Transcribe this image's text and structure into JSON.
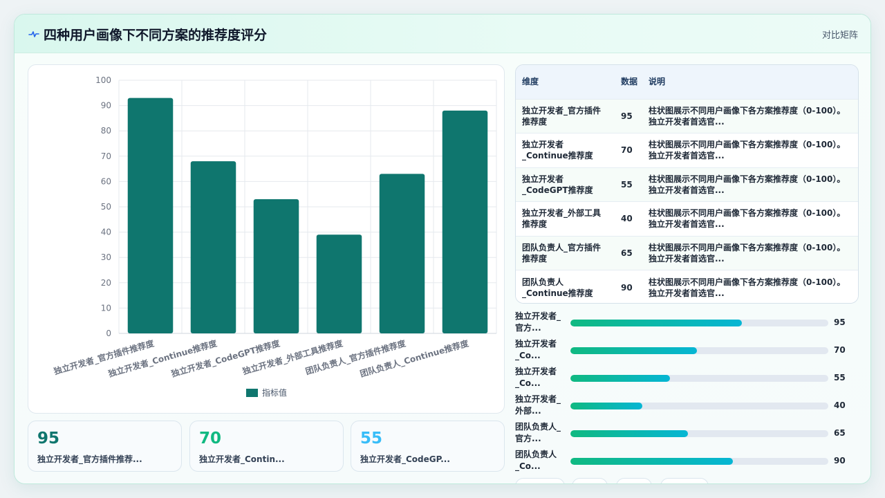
{
  "header": {
    "title": "四种用户画像下不同方案的推荐度评分",
    "right_label": "对比矩阵",
    "logo_icon": "pulse-icon"
  },
  "chart_data": {
    "type": "bar",
    "categories": [
      "独立开发者_官方插件推荐度",
      "独立开发者_Continue推荐度",
      "独立开发者_CodeGPT推荐度",
      "独立开发者_外部工具推荐度",
      "团队负责人_官方插件推荐度",
      "团队负责人_Continue推荐度"
    ],
    "series": [
      {
        "name": "指标值",
        "values": [
          93,
          68,
          53,
          39,
          63,
          88
        ]
      }
    ],
    "ylim": [
      0,
      100
    ],
    "yticks": [
      0,
      10,
      20,
      30,
      40,
      50,
      60,
      70,
      80,
      90,
      100
    ],
    "grid": true,
    "legend": "bottom",
    "bar_color": "#0f766e"
  },
  "stats": [
    {
      "value": "95",
      "label": "独立开发者_官方插件推荐...",
      "color": "#0f766e"
    },
    {
      "value": "70",
      "label": "独立开发者_Contin...",
      "color": "#10b981"
    },
    {
      "value": "55",
      "label": "独立开发者_CodeGP...",
      "color": "#38bdf8"
    }
  ],
  "table": {
    "headers": [
      "维度",
      "数据",
      "说明"
    ],
    "rows": [
      {
        "dim": "独立开发者_官方插件推荐度",
        "value": "95",
        "desc": "柱状图展示不同用户画像下各方案推荐度（0-100）。独立开发者首选官..."
      },
      {
        "dim": "独立开发者_Continue推荐度",
        "value": "70",
        "desc": "柱状图展示不同用户画像下各方案推荐度（0-100）。独立开发者首选官..."
      },
      {
        "dim": "独立开发者_CodeGPT推荐度",
        "value": "55",
        "desc": "柱状图展示不同用户画像下各方案推荐度（0-100）。独立开发者首选官..."
      },
      {
        "dim": "独立开发者_外部工具推荐度",
        "value": "40",
        "desc": "柱状图展示不同用户画像下各方案推荐度（0-100）。独立开发者首选官..."
      },
      {
        "dim": "团队负责人_官方插件推荐度",
        "value": "65",
        "desc": "柱状图展示不同用户画像下各方案推荐度（0-100）。独立开发者首选官..."
      },
      {
        "dim": "团队负责人_Continue推荐度",
        "value": "90",
        "desc": "柱状图展示不同用户画像下各方案推荐度（0-100）。独立开发者首选官..."
      }
    ]
  },
  "progress": [
    {
      "label": "独立开发者_官方...",
      "value": "95",
      "fraction": 0.665
    },
    {
      "label": "独立开发者_Co...",
      "value": "70",
      "fraction": 0.49
    },
    {
      "label": "独立开发者_Co...",
      "value": "55",
      "fraction": 0.385
    },
    {
      "label": "独立开发者_外部...",
      "value": "40",
      "fraction": 0.28
    },
    {
      "label": "团队负责人_官方...",
      "value": "65",
      "fraction": 0.455
    },
    {
      "label": "团队负责人_Co...",
      "value": "90",
      "fraction": 0.63
    }
  ]
}
